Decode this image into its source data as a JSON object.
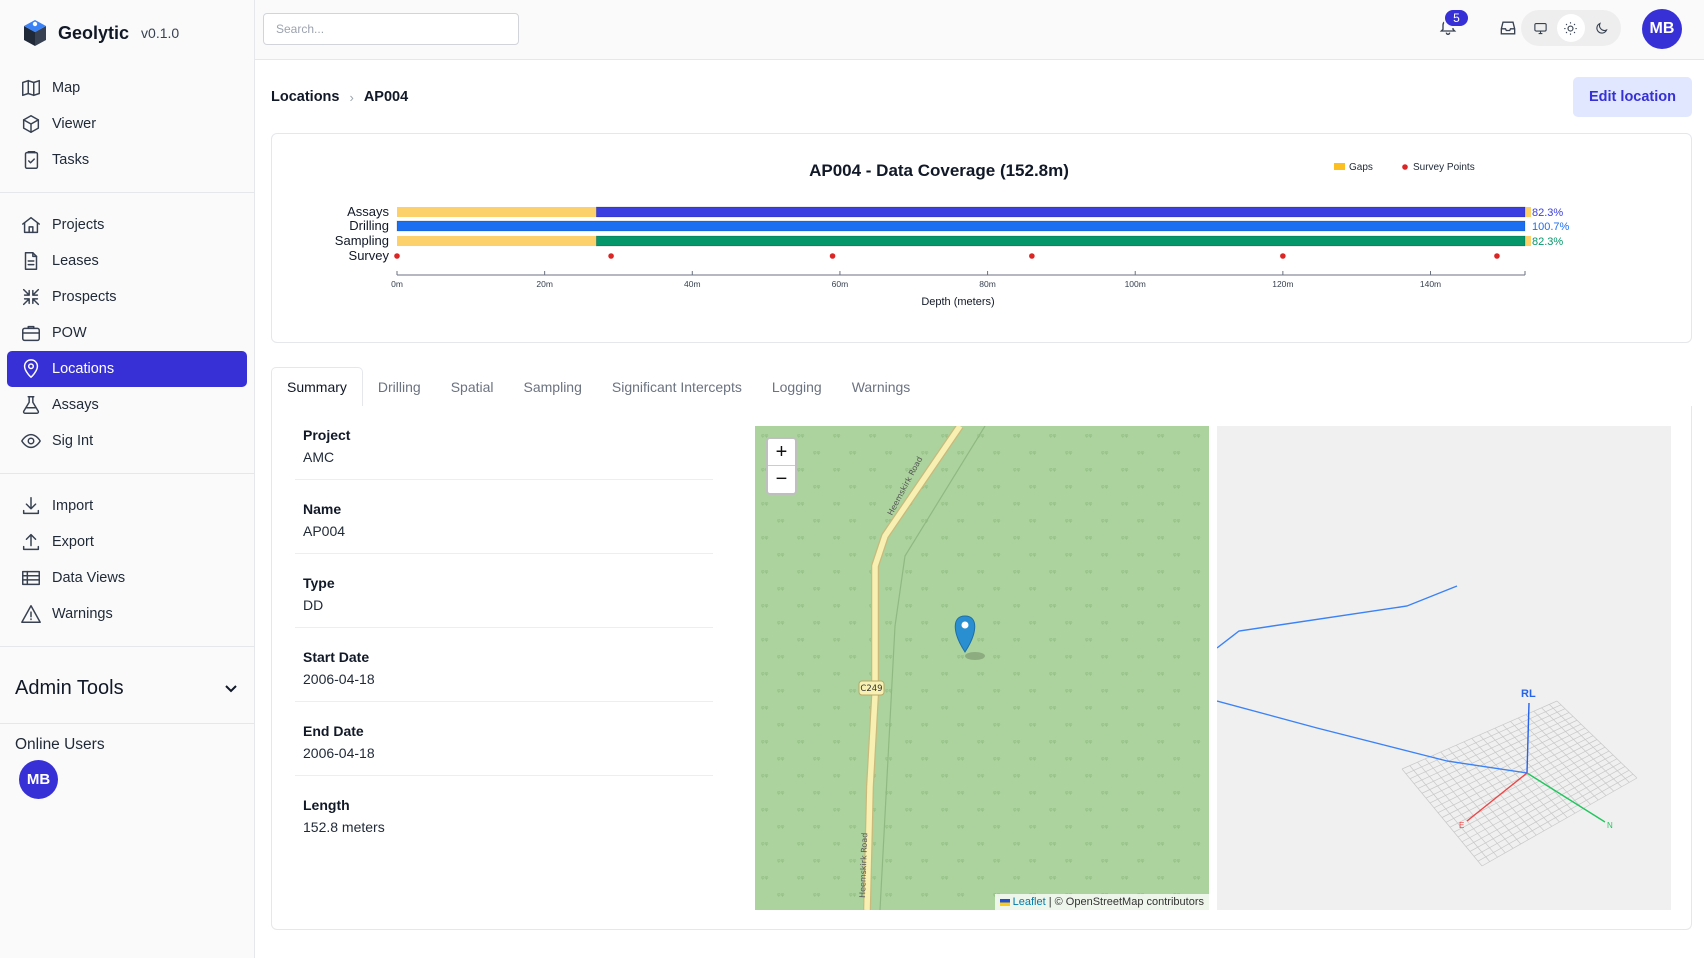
{
  "app": {
    "name": "Geolytic",
    "version": "v0.1.0"
  },
  "sidebar": {
    "groups": [
      [
        {
          "label": "Map",
          "icon": "map-icon"
        },
        {
          "label": "Viewer",
          "icon": "cube-icon"
        },
        {
          "label": "Tasks",
          "icon": "clipboard-icon"
        }
      ],
      [
        {
          "label": "Projects",
          "icon": "home-icon"
        },
        {
          "label": "Leases",
          "icon": "document-icon"
        },
        {
          "label": "Prospects",
          "icon": "arrows-in-icon"
        },
        {
          "label": "POW",
          "icon": "briefcase-icon"
        },
        {
          "label": "Locations",
          "icon": "location-pin-icon",
          "active": true
        },
        {
          "label": "Assays",
          "icon": "flask-icon"
        },
        {
          "label": "Sig Int",
          "icon": "eye-icon"
        }
      ],
      [
        {
          "label": "Import",
          "icon": "download-icon"
        },
        {
          "label": "Export",
          "icon": "upload-icon"
        },
        {
          "label": "Data Views",
          "icon": "table-icon"
        },
        {
          "label": "Warnings",
          "icon": "warning-icon"
        }
      ]
    ],
    "admin_label": "Admin Tools",
    "online_label": "Online Users",
    "online_user": "MB"
  },
  "topbar": {
    "search_placeholder": "Search...",
    "notification_count": "5",
    "user_initials": "MB"
  },
  "breadcrumb": {
    "root": "Locations",
    "current": "AP004"
  },
  "edit_button": "Edit location",
  "chart_data": {
    "type": "bar",
    "title": "AP004 - Data Coverage (152.8m)",
    "xlabel": "Depth (meters)",
    "xlim": [
      0,
      152.8
    ],
    "x_ticks": [
      "0m",
      "20m",
      "40m",
      "60m",
      "80m",
      "100m",
      "120m",
      "140m"
    ],
    "legend": [
      {
        "name": "Gaps",
        "color": "#fbbf24"
      },
      {
        "name": "Survey Points",
        "color": "#dc2626"
      }
    ],
    "legend_position": "top-right",
    "rows": [
      {
        "name": "Assays",
        "coverage_start": 27,
        "coverage_end": 152.8,
        "gap_start": 0,
        "gap_end": 27,
        "color": "#3b3ee0",
        "label": "82.3%"
      },
      {
        "name": "Drilling",
        "coverage_start": 0,
        "coverage_end": 152.8,
        "color": "#1d6ff2",
        "label": "100.7%"
      },
      {
        "name": "Sampling",
        "coverage_start": 27,
        "coverage_end": 152.8,
        "gap_start": 0,
        "gap_end": 27,
        "color": "#059669",
        "label": "82.3%"
      }
    ],
    "survey_row": "Survey",
    "survey_points": [
      0,
      29,
      59,
      86,
      120,
      149
    ]
  },
  "tabs": [
    "Summary",
    "Drilling",
    "Spatial",
    "Sampling",
    "Significant Intercepts",
    "Logging",
    "Warnings"
  ],
  "active_tab": "Summary",
  "summary": [
    {
      "key": "Project",
      "value": "AMC"
    },
    {
      "key": "Name",
      "value": "AP004"
    },
    {
      "key": "Type",
      "value": "DD"
    },
    {
      "key": "Start Date",
      "value": "2006-04-18"
    },
    {
      "key": "End Date",
      "value": "2006-04-18"
    },
    {
      "key": "Length",
      "value": "152.8 meters"
    }
  ],
  "map": {
    "road_name": "Heemskirk Road",
    "road_code": "C249",
    "zoom_in": "+",
    "zoom_out": "−",
    "attribution_leaflet": "Leaflet",
    "attribution_rest": " | © OpenStreetMap contributors"
  },
  "view3d": {
    "axis_up": "RL",
    "axis_east": "E",
    "axis_north": "N"
  }
}
